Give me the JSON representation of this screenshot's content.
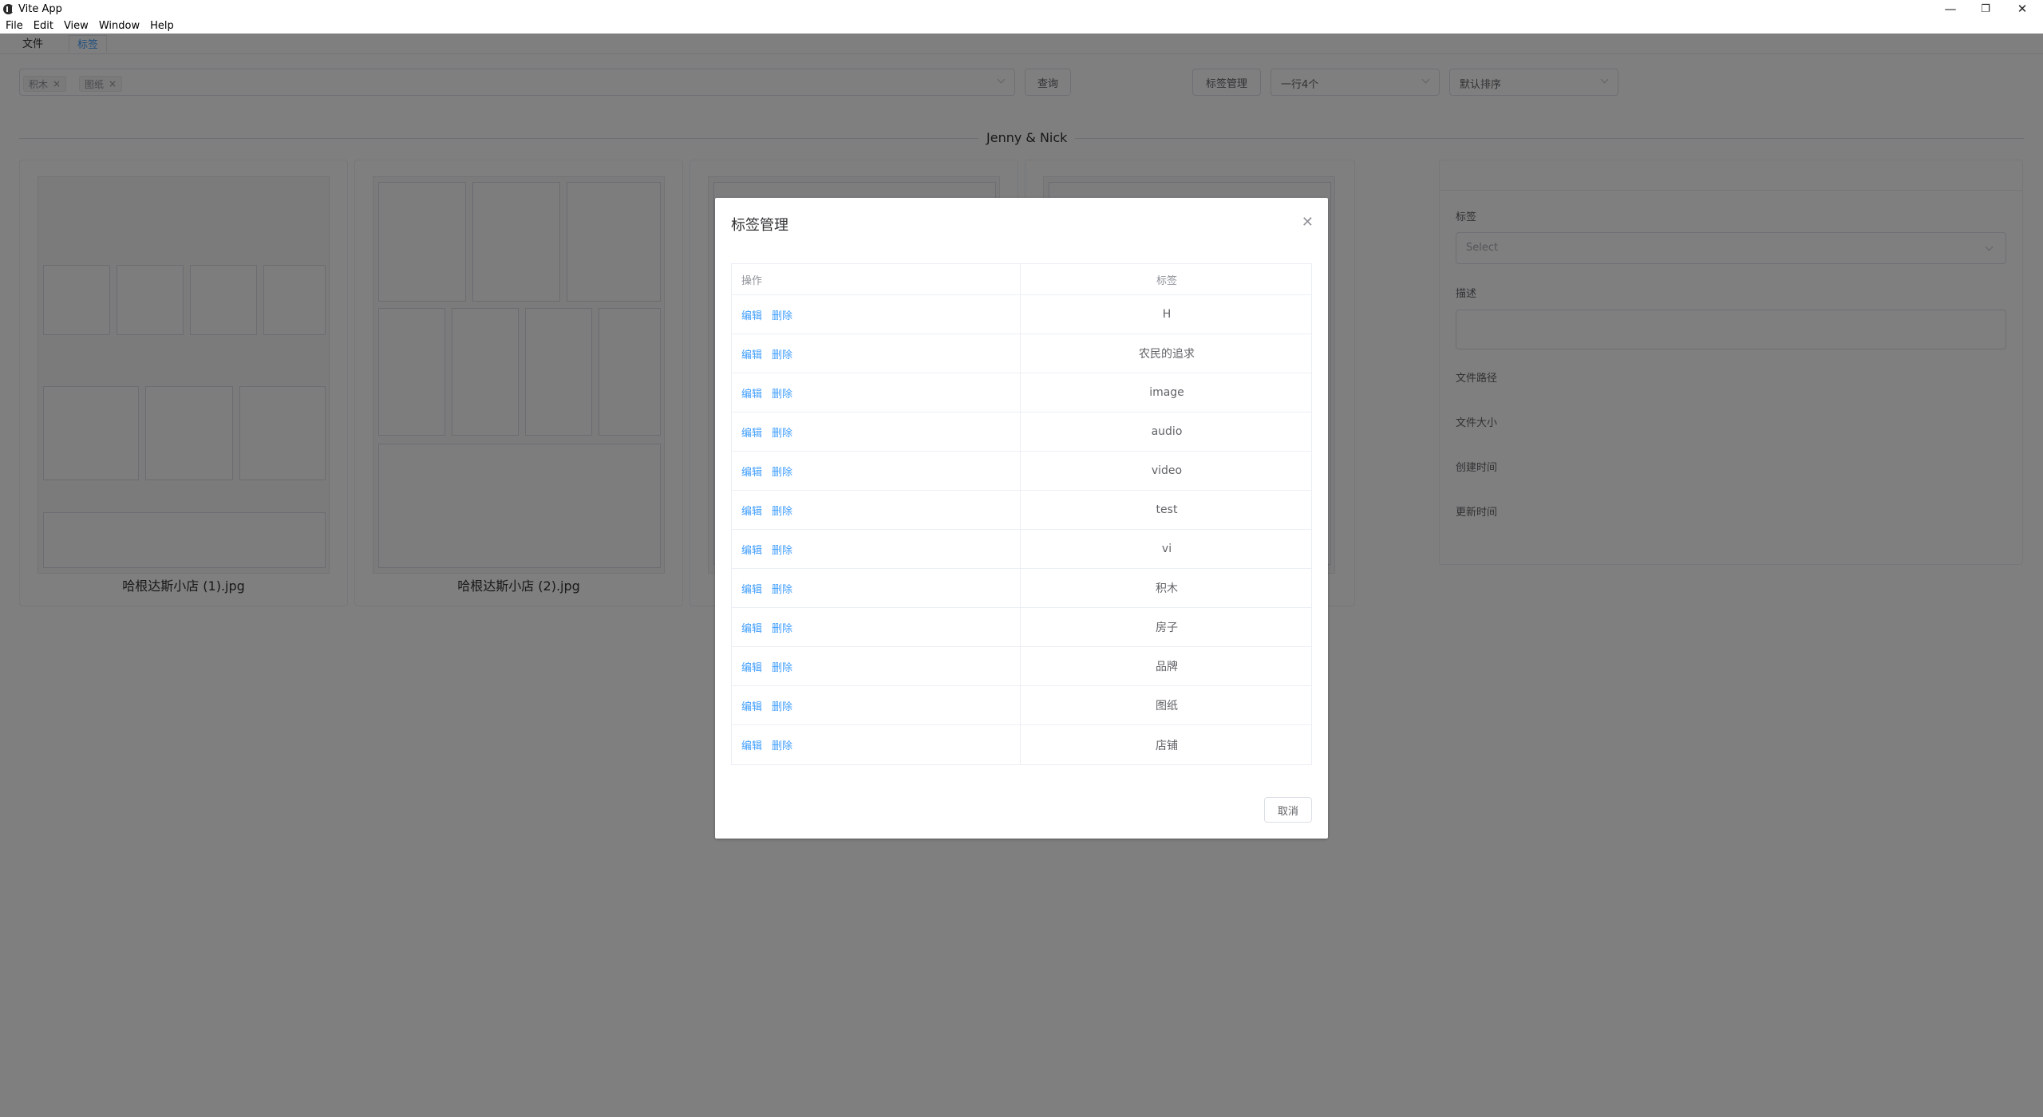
{
  "window": {
    "title": "Vite App",
    "minimize": "—",
    "restore": "❐",
    "close": "✕"
  },
  "menu": [
    "File",
    "Edit",
    "View",
    "Window",
    "Help"
  ],
  "tabs": [
    {
      "label": "文件"
    },
    {
      "label": "标签",
      "active": true
    }
  ],
  "filter": {
    "selected_tags": [
      "积木",
      "图纸"
    ],
    "query_label": "查询",
    "manage_label": "标签管理",
    "per_row": "一行4个",
    "sort": "默认排序"
  },
  "group_title": "Jenny & Nick",
  "cards": [
    {
      "name": "哈根达斯小店 (1).jpg"
    },
    {
      "name": "哈根达斯小店 (2).jpg"
    },
    {
      "name": ""
    },
    {
      "name": ""
    }
  ],
  "detail": {
    "tag_label": "标签",
    "tag_placeholder": "Select",
    "desc_label": "描述",
    "path_label": "文件路径",
    "size_label": "文件大小",
    "created_label": "创建时间",
    "updated_label": "更新时间"
  },
  "dialog": {
    "title": "标签管理",
    "col_action": "操作",
    "col_tag": "标签",
    "edit_label": "编辑",
    "delete_label": "删除",
    "rows": [
      "H",
      "农民的追求",
      "image",
      "audio",
      "video",
      "test",
      "vi",
      "积木",
      "房子",
      "品牌",
      "图纸",
      "店铺"
    ],
    "cancel_label": "取消"
  },
  "colors": {
    "accent": "#409eff",
    "overlay": "rgba(0,0,0,0.5)"
  }
}
